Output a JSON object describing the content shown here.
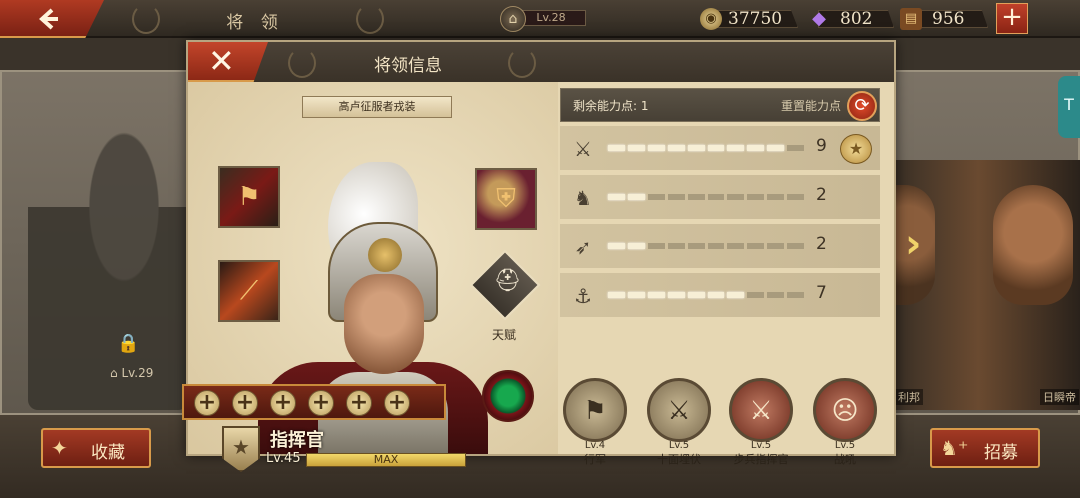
{
  "top": {
    "title": "将 领",
    "level": "Lv.28",
    "resources": [
      {
        "icon": "coin-icon",
        "value": "37750"
      },
      {
        "icon": "gem-icon",
        "value": "802"
      },
      {
        "icon": "chest-icon",
        "value": "956"
      }
    ],
    "plus": "+"
  },
  "background": {
    "locked_level": "Lv.29",
    "right_names": [
      "利邦",
      "日瞬帝"
    ],
    "side_tab": "T"
  },
  "bottom": {
    "favorite_label": "收藏",
    "recruit_label": "招募"
  },
  "dialog": {
    "title": "将领信息",
    "outfit_tag": "高卢征服者戎装",
    "talent_label": "天赋",
    "hero_name": "指挥官",
    "hero_level": "Lv.45",
    "level_bar": "MAX",
    "slot_count": 6,
    "points_label": "剩余能力点: 1",
    "reset_label": "重置能力点",
    "attributes": [
      {
        "icon": "sword-icon",
        "value": "9",
        "level": 9,
        "max": 10
      },
      {
        "icon": "horse-icon",
        "value": "2",
        "level": 2,
        "max": 10
      },
      {
        "icon": "bow-icon",
        "value": "2",
        "level": 2,
        "max": 10
      },
      {
        "icon": "anchor-icon",
        "value": "7",
        "level": 7,
        "max": 10
      }
    ],
    "skills": [
      {
        "level": "Lv.4",
        "name": "行军",
        "style": "neutral"
      },
      {
        "level": "Lv.5",
        "name": "十面埋伏",
        "style": "neutral"
      },
      {
        "level": "Lv.5",
        "name": "步兵指挥官",
        "style": "red"
      },
      {
        "level": "Lv.5",
        "name": "战吼",
        "style": "red"
      }
    ]
  },
  "colors": {
    "accent_red": "#b03a22",
    "gold": "#d89a4a",
    "panel": "#e6d7b3"
  }
}
